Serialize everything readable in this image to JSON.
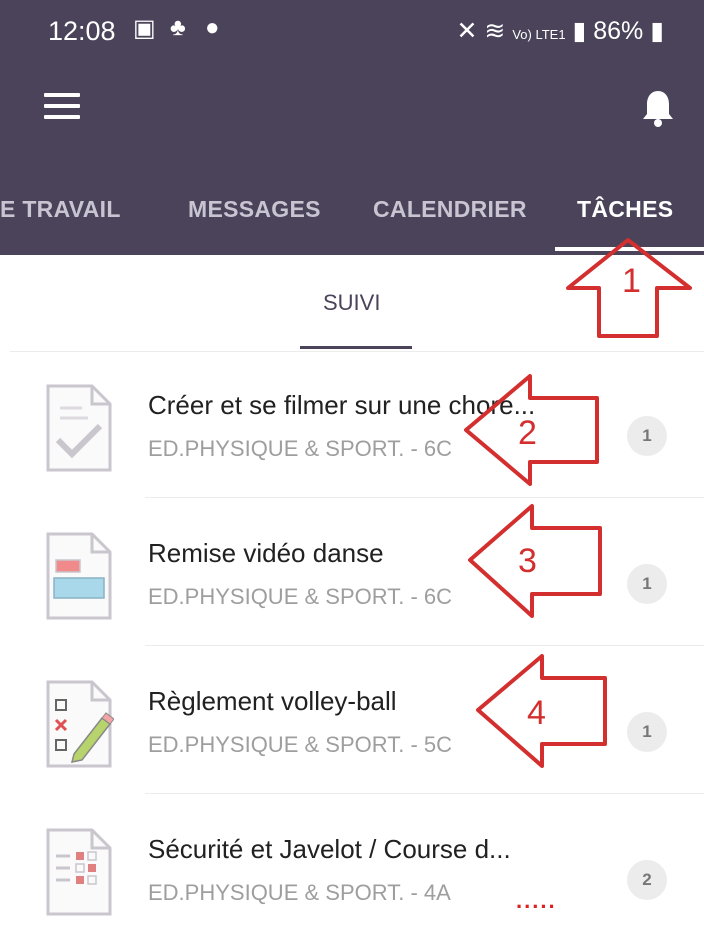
{
  "status_bar": {
    "time": "12:08",
    "signal": "Vo) LTE1",
    "battery": "86%"
  },
  "tabs": [
    {
      "label": "E TRAVAIL",
      "active": false
    },
    {
      "label": "MESSAGES",
      "active": false
    },
    {
      "label": "CALENDRIER",
      "active": false
    },
    {
      "label": "TÂCHES",
      "active": true
    }
  ],
  "subtab": "SUIVI",
  "tasks": [
    {
      "title": "Créer et se filmer sur une choré...",
      "subtitle": "ED.PHYSIQUE & SPORT. - 6C",
      "badge": "1",
      "icon": "checked-doc-icon"
    },
    {
      "title": "Remise vidéo danse",
      "subtitle": "ED.PHYSIQUE & SPORT. - 6C",
      "badge": "1",
      "icon": "form-doc-icon"
    },
    {
      "title": "Règlement volley-ball",
      "subtitle": "ED.PHYSIQUE & SPORT. - 5C",
      "badge": "1",
      "icon": "checklist-pencil-icon"
    },
    {
      "title": "Sécurité et  Javelot / Course d...",
      "subtitle": "ED.PHYSIQUE & SPORT. - 4A",
      "badge": "2",
      "icon": "grid-doc-icon",
      "trailing": "....."
    }
  ],
  "annotations": [
    {
      "label": "1",
      "color": "#d32f2f"
    },
    {
      "label": "2",
      "color": "#d32f2f"
    },
    {
      "label": "3",
      "color": "#d32f2f"
    },
    {
      "label": "4",
      "color": "#d32f2f"
    }
  ],
  "colors": {
    "header": "#4a4359",
    "accent": "#ffffff",
    "badge": "#ececec",
    "annotation": "#d32f2f"
  }
}
